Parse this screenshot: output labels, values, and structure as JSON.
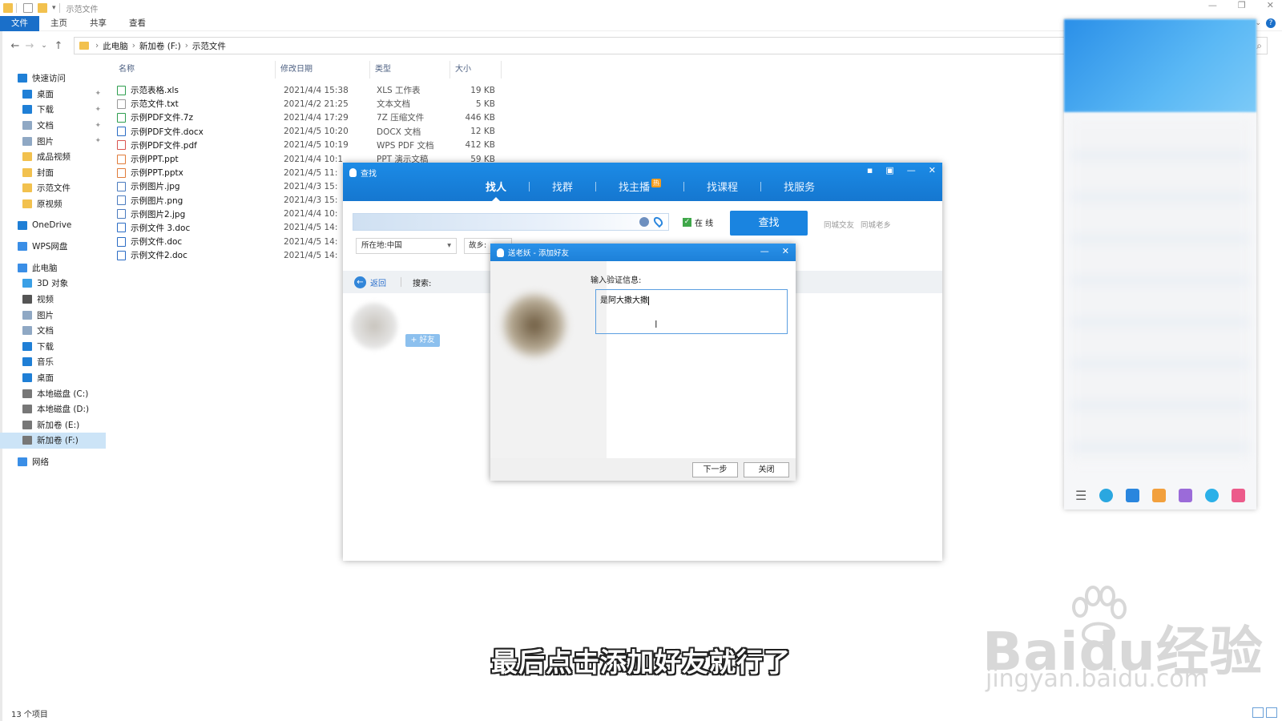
{
  "explorer": {
    "window_title": "示范文件",
    "ribbon_tabs": [
      "文件",
      "主页",
      "共享",
      "查看"
    ],
    "breadcrumb": [
      "此电脑",
      "新加卷 (F:)",
      "示范文件"
    ],
    "nav_items": [
      {
        "label": "快速访问",
        "icon": "star-icon",
        "color": "#1f7fd6",
        "pinned": false
      },
      {
        "label": "桌面",
        "icon": "desktop-icon",
        "color": "#1f7fd6",
        "pinned": true
      },
      {
        "label": "下载",
        "icon": "download-icon",
        "color": "#1f7fd6",
        "pinned": true
      },
      {
        "label": "文档",
        "icon": "document-icon",
        "color": "#8fa8c4",
        "pinned": true
      },
      {
        "label": "图片",
        "icon": "picture-icon",
        "color": "#8fa8c4",
        "pinned": true
      },
      {
        "label": "成品视频",
        "icon": "folder-icon",
        "color": "#f2c14e",
        "pinned": false
      },
      {
        "label": "封面",
        "icon": "folder-icon",
        "color": "#f2c14e",
        "pinned": false
      },
      {
        "label": "示范文件",
        "icon": "folder-icon",
        "color": "#f2c14e",
        "pinned": false
      },
      {
        "label": "原视频",
        "icon": "folder-icon",
        "color": "#f2c14e",
        "pinned": false
      },
      {
        "label": "OneDrive",
        "icon": "cloud-icon",
        "color": "#1f7fd6",
        "pinned": false
      },
      {
        "label": "WPS网盘",
        "icon": "cloud-icon",
        "color": "#3a8ee6",
        "pinned": false
      },
      {
        "label": "此电脑",
        "icon": "computer-icon",
        "color": "#3a8ee6",
        "pinned": false
      },
      {
        "label": "3D 对象",
        "icon": "cube-icon",
        "color": "#3aa0e6",
        "pinned": false
      },
      {
        "label": "视频",
        "icon": "video-icon",
        "color": "#555555",
        "pinned": false
      },
      {
        "label": "图片",
        "icon": "picture-icon",
        "color": "#8fa8c4",
        "pinned": false
      },
      {
        "label": "文档",
        "icon": "document-icon",
        "color": "#8fa8c4",
        "pinned": false
      },
      {
        "label": "下载",
        "icon": "download-icon",
        "color": "#1f7fd6",
        "pinned": false
      },
      {
        "label": "音乐",
        "icon": "music-icon",
        "color": "#1f7fd6",
        "pinned": false
      },
      {
        "label": "桌面",
        "icon": "desktop-icon",
        "color": "#1f7fd6",
        "pinned": false
      },
      {
        "label": "本地磁盘 (C:)",
        "icon": "drive-icon",
        "color": "#777777",
        "pinned": false
      },
      {
        "label": "本地磁盘 (D:)",
        "icon": "drive-icon",
        "color": "#777777",
        "pinned": false
      },
      {
        "label": "新加卷 (E:)",
        "icon": "drive-icon",
        "color": "#777777",
        "pinned": false
      },
      {
        "label": "新加卷 (F:)",
        "icon": "drive-icon",
        "color": "#777777",
        "pinned": false
      },
      {
        "label": "网络",
        "icon": "network-icon",
        "color": "#3a8ee6",
        "pinned": false
      }
    ],
    "columns": [
      "名称",
      "修改日期",
      "类型",
      "大小"
    ],
    "files": [
      {
        "name": "示范表格.xls",
        "date": "2021/4/4 15:38",
        "type": "XLS 工作表",
        "size": "19 KB",
        "color": "#2e9e4f"
      },
      {
        "name": "示范文件.txt",
        "date": "2021/4/2 21:25",
        "type": "文本文档",
        "size": "5 KB",
        "color": "#999999"
      },
      {
        "name": "示例PDF文件.7z",
        "date": "2021/4/4 17:29",
        "type": "7Z 压缩文件",
        "size": "446 KB",
        "color": "#2e9e4f"
      },
      {
        "name": "示例PDF文件.docx",
        "date": "2021/4/5 10:20",
        "type": "DOCX 文档",
        "size": "12 KB",
        "color": "#2b6cc4"
      },
      {
        "name": "示例PDF文件.pdf",
        "date": "2021/4/5 10:19",
        "type": "WPS PDF 文档",
        "size": "412 KB",
        "color": "#d9534f"
      },
      {
        "name": "示例PPT.ppt",
        "date": "2021/4/4 10:1",
        "type": "PPT 演示文稿",
        "size": "59 KB",
        "color": "#e07b39"
      },
      {
        "name": "示例PPT.pptx",
        "date": "2021/4/5 11:",
        "type": "",
        "size": "",
        "color": "#e07b39"
      },
      {
        "name": "示例图片.jpg",
        "date": "2021/4/3 15:",
        "type": "",
        "size": "",
        "color": "#4a7bbf"
      },
      {
        "name": "示例图片.png",
        "date": "2021/4/3 15:",
        "type": "",
        "size": "",
        "color": "#4a7bbf"
      },
      {
        "name": "示例图片2.jpg",
        "date": "2021/4/4 10:",
        "type": "",
        "size": "",
        "color": "#4a7bbf"
      },
      {
        "name": "示例文件 3.doc",
        "date": "2021/4/5 14:",
        "type": "",
        "size": "",
        "color": "#2b6cc4"
      },
      {
        "name": "示例文件.doc",
        "date": "2021/4/5 14:",
        "type": "",
        "size": "",
        "color": "#2b6cc4"
      },
      {
        "name": "示例文件2.doc",
        "date": "2021/4/5 14:",
        "type": "",
        "size": "",
        "color": "#2b6cc4"
      }
    ],
    "status": "13 个项目"
  },
  "qq_find": {
    "title": "查找",
    "tabs": [
      "找人",
      "找群",
      "找主播",
      "找课程",
      "找服务"
    ],
    "hot_badge": "热",
    "online_label": "在 线",
    "find_button": "查找",
    "links": [
      "同城交友",
      "同城老乡"
    ],
    "location_select": "所在地:中国",
    "hometown_select": "故乡:",
    "back_label": "返回",
    "search_label": "搜索:",
    "add_friend_button": "+ 好友"
  },
  "add_friend_dialog": {
    "title": "送老妖 - 添加好友",
    "prompt": "输入验证信息:",
    "message": "是阿大撒大撒",
    "next_button": "下一步",
    "close_button": "关闭"
  },
  "overlay": {
    "subtitle": "最后点击添加好友就行了",
    "watermark": "Baidu经验",
    "watermark_url": "jingyan.baidu.com"
  },
  "colors": {
    "accent_blue": "#1a84e0",
    "file_tab": "#1a6fc9"
  }
}
